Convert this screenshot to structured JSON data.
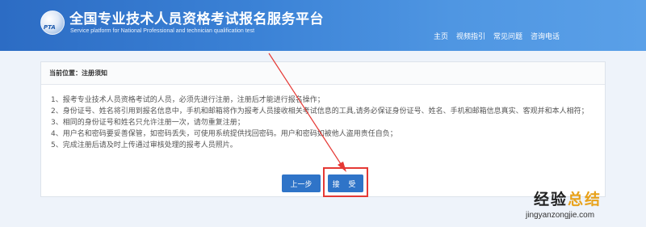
{
  "header": {
    "logo_text": "PTA",
    "title": "全国专业技术人员资格考试报名服务平台",
    "subtitle": "Service platform for National Professional and technician qualification test",
    "nav": [
      "主页",
      "视频指引",
      "常见问题",
      "咨询电话"
    ]
  },
  "panel": {
    "breadcrumb": "当前位置：注册须知",
    "rules": [
      "1、报考专业技术人员资格考试的人员，必须先进行注册，注册后才能进行报名操作；",
      "2、身份证号、姓名将引用到报名信息中，手机和邮箱将作为报考人员接收相关考试信息的工具,请务必保证身份证号、姓名、手机和邮箱信息真实、客观并和本人相符；",
      "3、相同的身份证号和姓名只允许注册一次，请勿重复注册；",
      "4、用户名和密码要妥善保管，如密码丢失，可使用系统提供找回密码。用户和密码如被他人盗用责任自负；",
      "5、完成注册后请及时上传通过审核处理的报考人员照片。"
    ],
    "prev_button": "上一步",
    "accept_button": "接 受"
  },
  "watermark": {
    "main_a": "经验",
    "main_b": "总结",
    "url": "jingyanzongjie.com"
  },
  "colors": {
    "header_blue": "#3b82d6",
    "button_blue": "#2f74c8",
    "highlight_red": "#e53935",
    "watermark_accent": "#e8a21b"
  }
}
